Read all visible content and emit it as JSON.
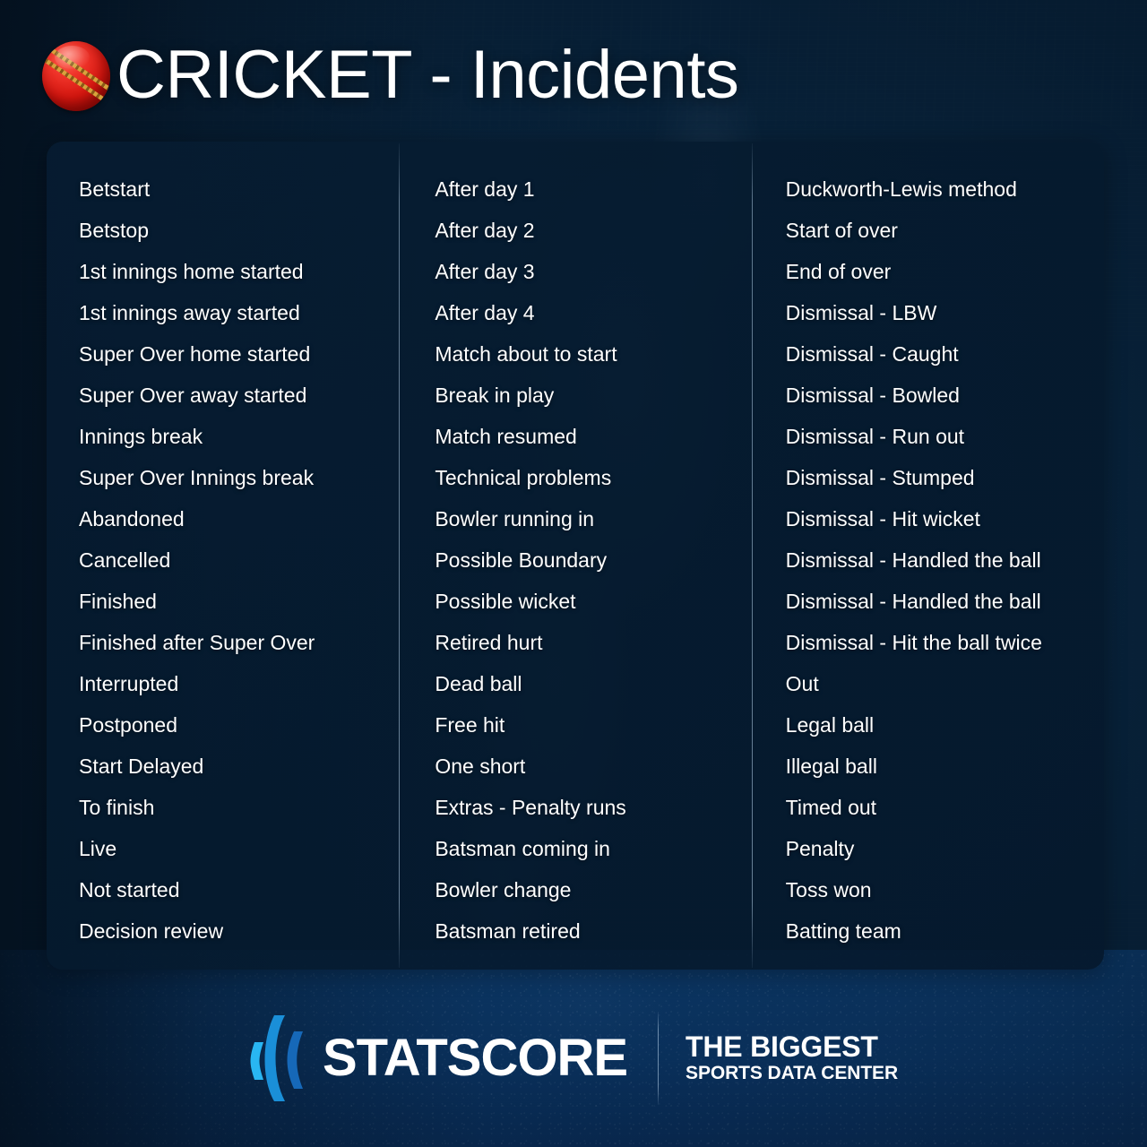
{
  "header": {
    "icon": "cricket-ball-icon",
    "title_bold": "CRICKET",
    "title_separator": " - ",
    "title_light": "Incidents",
    "title_full": "CRICKET - Incidents"
  },
  "colors": {
    "accent_blue": "#0f64b4",
    "panel_navy": "#061c32",
    "ball_red": "#d4160f",
    "ball_seam": "#d8a23c",
    "logo_arc_light": "#29b6f2",
    "logo_arc_mid": "#1a8fd8",
    "logo_arc_dark": "#1668b8",
    "text_white": "#ffffff"
  },
  "columns": [
    {
      "name": "match-status-column",
      "items": [
        "Betstart",
        "Betstop",
        "1st innings home started",
        "1st innings away started",
        "Super Over home started",
        "Super Over away started",
        "Innings break",
        "Super Over Innings break",
        "Abandoned",
        "Cancelled",
        "Finished",
        "Finished after Super Over",
        "Interrupted",
        "Postponed",
        "Start Delayed",
        "To finish",
        "Live",
        "Not started",
        "Decision review"
      ]
    },
    {
      "name": "match-events-column",
      "items": [
        "After day 1",
        "After day 2",
        "After day 3",
        "After day 4",
        "Match about to start",
        "Break in play",
        "Match resumed",
        "Technical problems",
        "Bowler running in",
        "Possible Boundary",
        "Possible wicket",
        "Retired hurt",
        "Dead ball",
        "Free hit",
        "One short",
        "Extras - Penalty runs",
        "Batsman coming in",
        "Bowler change",
        "Batsman retired"
      ]
    },
    {
      "name": "dismissals-column",
      "items": [
        "Duckworth-Lewis method",
        "Start of over",
        "End of over",
        "Dismissal - LBW",
        "Dismissal - Caught",
        "Dismissal - Bowled",
        "Dismissal - Run out",
        "Dismissal - Stumped",
        "Dismissal - Hit wicket",
        "Dismissal - Handled the ball",
        "Dismissal - Handled the ball",
        "Dismissal - Hit the ball twice",
        "Out",
        "Legal ball",
        "Illegal ball",
        "Timed out",
        "Penalty",
        "Toss won",
        "Batting team"
      ]
    }
  ],
  "footer": {
    "brand": "STATSCORE",
    "tagline_line1": "THE BIGGEST",
    "tagline_line2": "SPORTS DATA CENTER",
    "logo_icon": "statscore-arcs-icon"
  }
}
